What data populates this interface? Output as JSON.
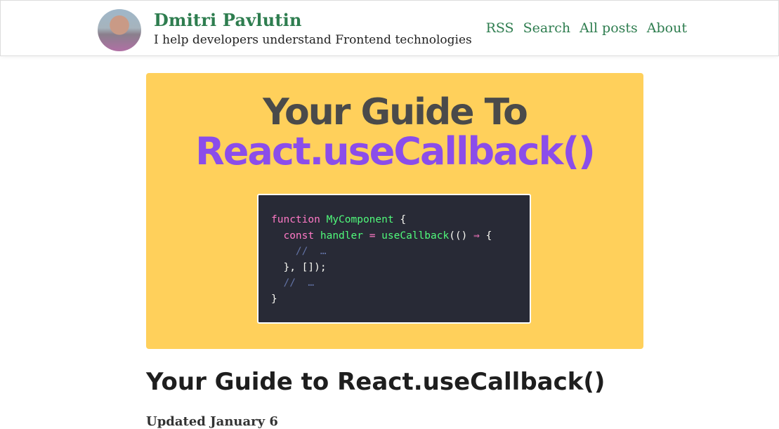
{
  "header": {
    "name": "Dmitri Pavlutin",
    "tagline": "I help developers understand Frontend technologies",
    "nav": [
      "RSS",
      "Search",
      "All posts",
      "About"
    ]
  },
  "cover": {
    "line1": "Your Guide To",
    "line2": "React.useCallback()",
    "code": {
      "l1_kw": "function",
      "l1_fn": "MyComponent",
      "l1_rest": " {",
      "l2_kw": "const",
      "l2_var": " handler ",
      "l2_eq": "=",
      "l2_fn": " useCallback",
      "l2_rest": "(() ",
      "l2_arrow": "⇒",
      "l2_end": " {",
      "l3_comment": "//  …",
      "l4": "}, []);",
      "l5_comment": "//  …",
      "l6": "}"
    }
  },
  "post": {
    "title": "Your Guide to React.useCallback()",
    "byline": "Updated January 6"
  },
  "colors": {
    "brand_green": "#2e7d4f",
    "cover_bg": "#ffd05b",
    "cover_purple": "#8b4dea",
    "code_bg": "#282a36"
  }
}
